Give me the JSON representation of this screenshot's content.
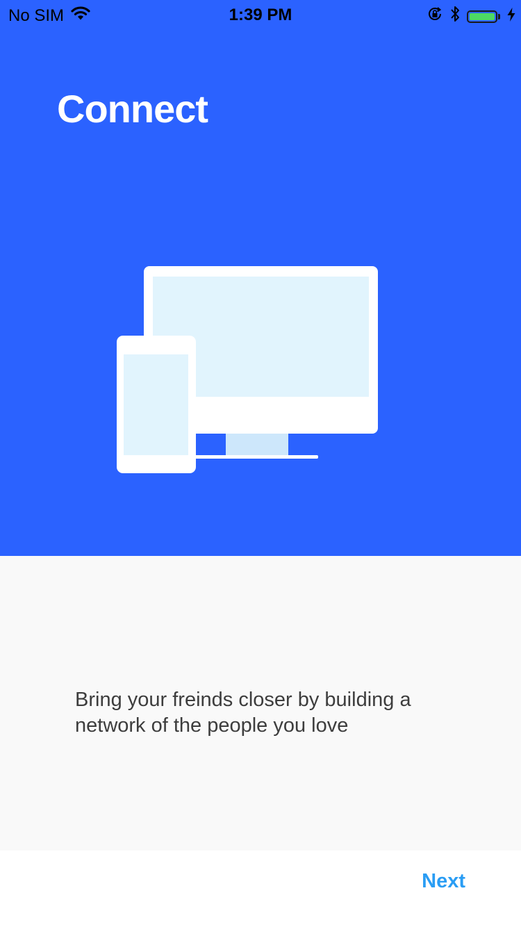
{
  "status_bar": {
    "carrier": "No SIM",
    "time": "1:39 PM",
    "icons": [
      "wifi-icon",
      "orientation-lock-icon",
      "bluetooth-icon",
      "battery-icon",
      "charging-icon"
    ],
    "battery_level": 1.0
  },
  "onboarding": {
    "title": "Connect",
    "illustration": "devices-illustration",
    "description": "Bring your freinds closer by building a network of the people you love"
  },
  "footer": {
    "next_label": "Next"
  },
  "colors": {
    "hero_background": "#2b62ff",
    "body_background": "#f9f9f9",
    "accent": "#2a9df4",
    "text": "#3d3d3d",
    "screen_fill": "#e1f4fd",
    "stand_fill": "#cde7fb"
  }
}
